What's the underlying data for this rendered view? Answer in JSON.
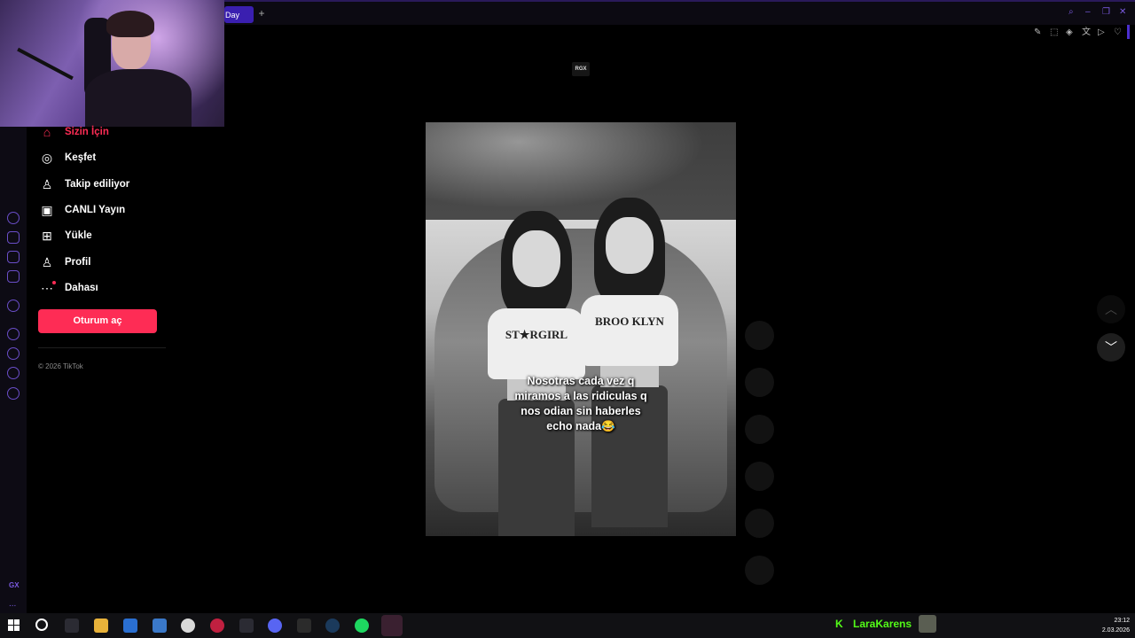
{
  "browser": {
    "active_tab_label": "Day",
    "new_tab_symbol": "+",
    "gx_label": "GX",
    "gx_more": "...",
    "accent_color": "#4b2fd0"
  },
  "nav": {
    "items": [
      {
        "label": "Sizin İçin",
        "icon": "home-icon",
        "active": true
      },
      {
        "label": "Keşfet",
        "icon": "compass-icon"
      },
      {
        "label": "Takip ediliyor",
        "icon": "following-icon"
      },
      {
        "label": "CANLI Yayın",
        "icon": "live-tv-icon"
      },
      {
        "label": "Yükle",
        "icon": "upload-icon"
      },
      {
        "label": "Profil",
        "icon": "profile-icon"
      },
      {
        "label": "Dahası",
        "icon": "more-icon"
      }
    ],
    "login_label": "Oturum aç",
    "copyright": "© 2026 TikTok",
    "accent_color": "#fe2c55"
  },
  "video": {
    "creator_tag": "RGX",
    "caption_lines": [
      "Nosotras cada vez q",
      "miramos a las ridiculas q",
      "nos odian sin haberles",
      "echo nada😂"
    ],
    "shirt_left": "ST★RGIRL",
    "shirt_right": "BROO KLYN"
  },
  "taskbar": {
    "kick_logo": "K",
    "kick_name": "LaraKarens",
    "kick_color": "#53fc18",
    "time": "23:12",
    "date": "2.03.2026"
  }
}
